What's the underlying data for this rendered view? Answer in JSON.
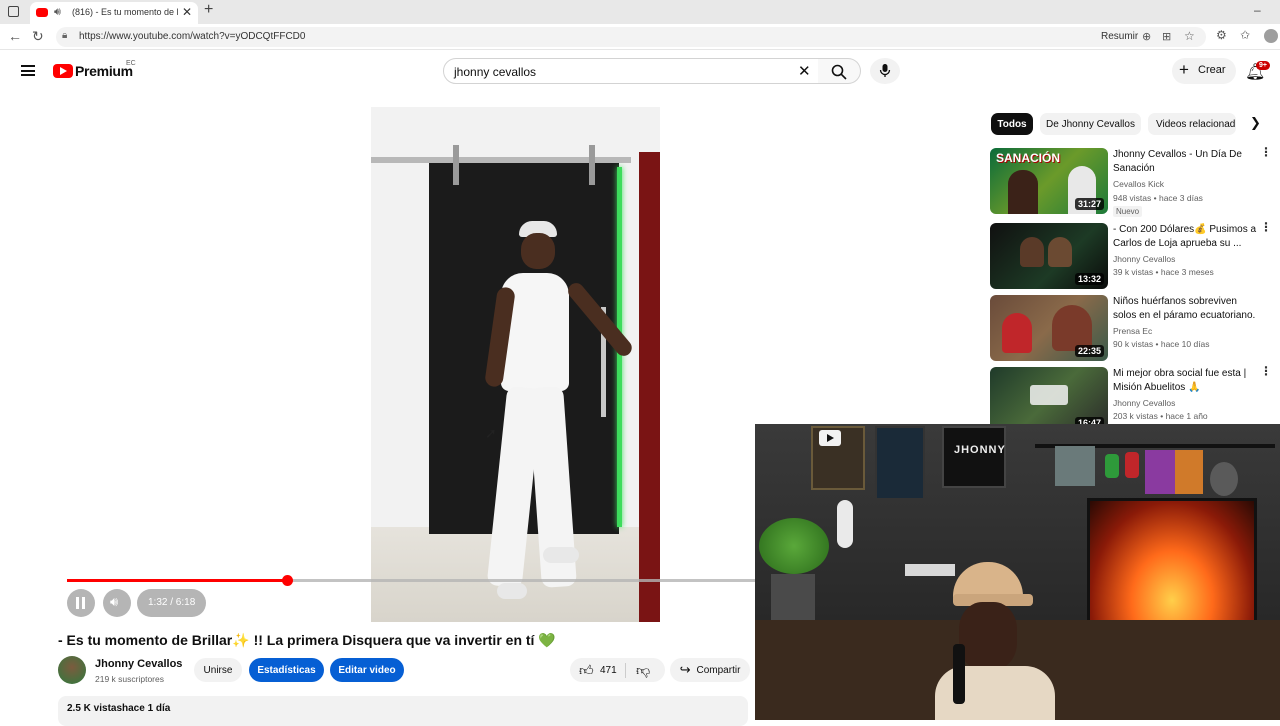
{
  "browser": {
    "tab_title": "(816) - Es tu momento de Br",
    "url": "https://www.youtube.com/watch?v=yODCQtFFCD0",
    "summarize_label": "Resumir"
  },
  "header": {
    "logo_text": "Premium",
    "region": "EC",
    "search_value": "jhonny cevallos",
    "create_label": "Crear",
    "notif_count": "9+"
  },
  "player": {
    "time_label": "1:32 / 6:18",
    "progress_fraction": 0.32
  },
  "video": {
    "title": "- Es tu momento de Brillar✨ !! La primera Disquera que va invertir en tí 💚",
    "channel": "Jhonny Cevallos",
    "subscribers": "219 k suscriptores",
    "join_label": "Unirse",
    "stats_label": "Estadísticas",
    "edit_label": "Editar video",
    "likes": "471",
    "share_label": "Compartir",
    "views": "2.5 K vistas",
    "date": "hace 1 día"
  },
  "chips": [
    "Todos",
    "De Jhonny Cevallos",
    "Videos relacionad"
  ],
  "recommendations": [
    {
      "title": "Jhonny Cevallos - Un Día De Sanación",
      "channel": "Cevallos Kick",
      "meta": "948 vistas • hace 3 días",
      "badge": "Nuevo",
      "duration": "31:27",
      "thumb_text": "SANACIÓN"
    },
    {
      "title": "- Con 200 Dólares💰 Pusimos a Carlos de Loja aprueba su ...",
      "channel": "Jhonny Cevallos",
      "meta": "39 k vistas • hace 3 meses",
      "badge": "",
      "duration": "13:32",
      "thumb_text": ""
    },
    {
      "title": "Niños huérfanos sobreviven solos en el páramo ecuatoriano.",
      "channel": "Prensa Ec",
      "meta": "90 k vistas • hace 10 días",
      "badge": "",
      "duration": "22:35",
      "thumb_text": ""
    },
    {
      "title": "Mi mejor obra social fue esta | Misión Abuelitos 🙏",
      "channel": "Jhonny Cevallos",
      "meta": "203 k vistas • hace 1 año",
      "badge": "",
      "duration": "16:47",
      "thumb_text": ""
    }
  ],
  "webcam": {
    "sign_text": "JHONNY"
  }
}
